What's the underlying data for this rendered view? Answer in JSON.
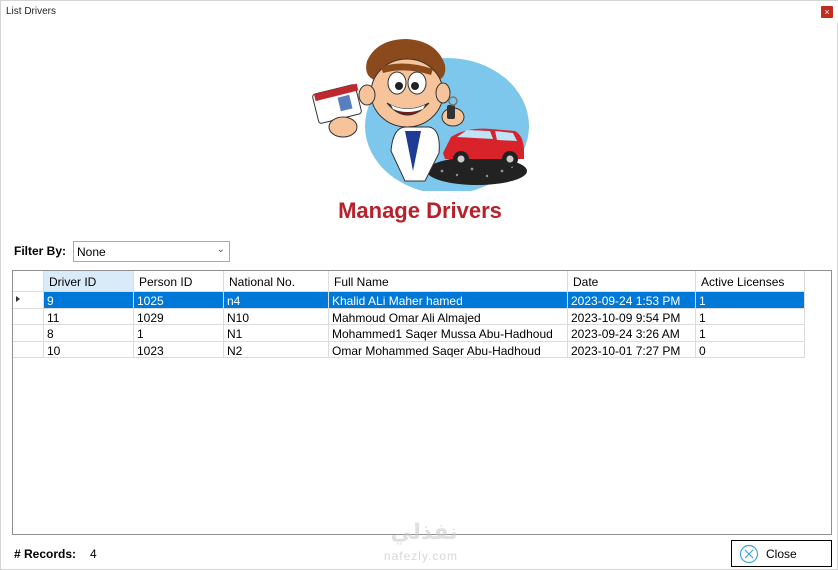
{
  "window": {
    "title": "List Drivers",
    "close_glyph": "×"
  },
  "header": {
    "title": "Manage Drivers"
  },
  "filter": {
    "label": "Filter By:",
    "selected": "None"
  },
  "grid": {
    "columns": [
      "Driver ID",
      "Person ID",
      "National No.",
      "Full Name",
      "Date",
      "Active Licenses"
    ],
    "rows": [
      [
        "9",
        "1025",
        "n4",
        "Khalid ALi Maher hamed",
        "2023-09-24 1:53 PM",
        "1"
      ],
      [
        "11",
        "1029",
        "N10",
        "Mahmoud Omar Ali Almajed",
        "2023-10-09 9:54 PM",
        "1"
      ],
      [
        "8",
        "1",
        "N1",
        "Mohammed1 Saqer Mussa Abu-Hadhoud",
        "2023-09-24 3:26 AM",
        "1"
      ],
      [
        "10",
        "1023",
        "N2",
        "Omar Mohammed Saqer Abu-Hadhoud",
        "2023-10-01 7:27 PM",
        "0"
      ]
    ],
    "selected_row": 0
  },
  "footer": {
    "records_label": "# Records:",
    "records_count": "4",
    "close_label": "Close"
  },
  "watermark": {
    "text": "نفذلي",
    "sub": "nafezly.com"
  },
  "colors": {
    "accent": "#0078d7",
    "title_red": "#b8202a"
  },
  "icons": {
    "close_button": "close-circle-icon",
    "row_pointer": "row-pointer-icon"
  }
}
